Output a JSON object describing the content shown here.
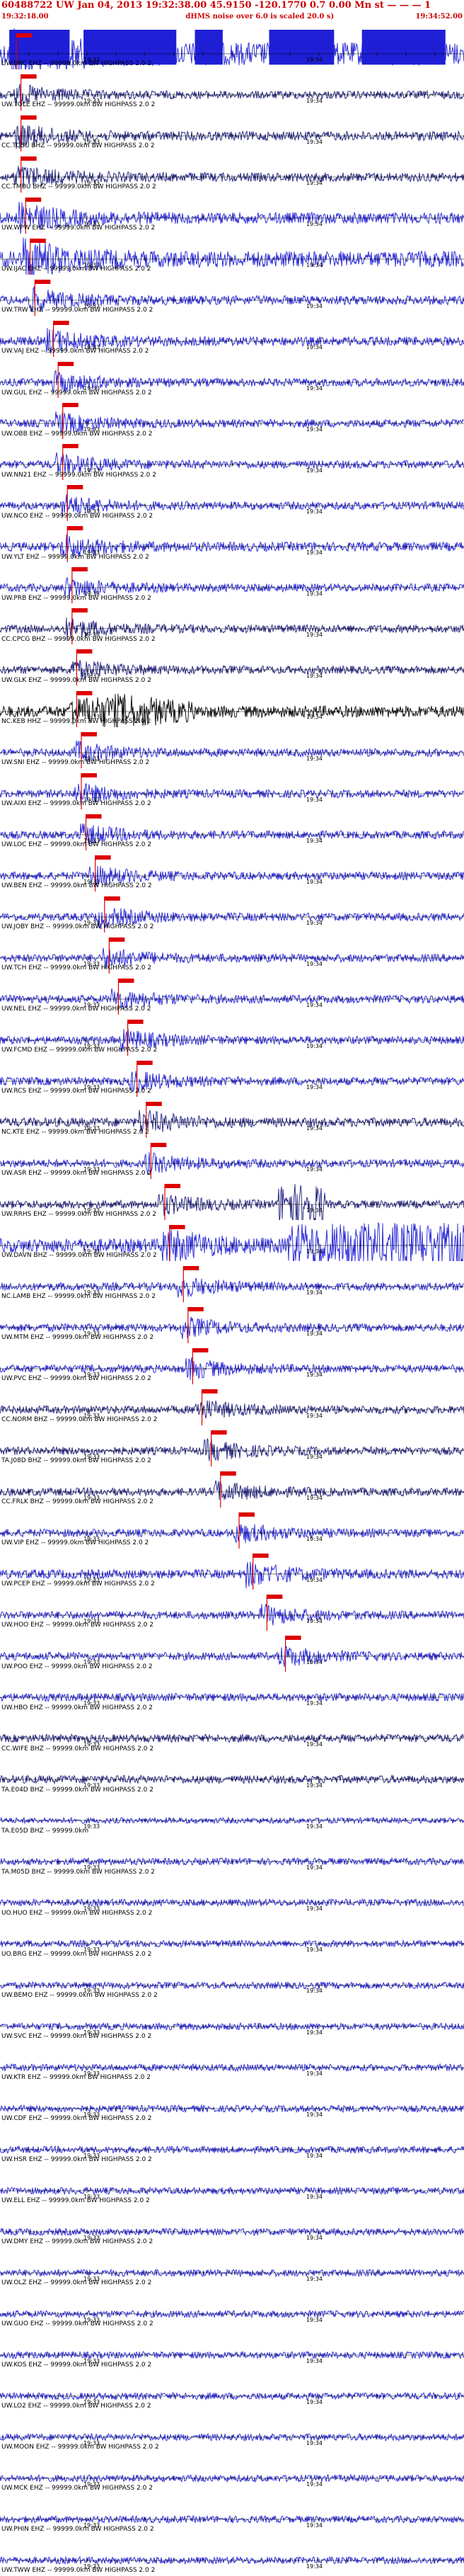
{
  "header": {
    "title": "60488722 UW Jan 04, 2013 19:32:38.00   45.9150 -120.1770  0.7 0.00 Mn st — — — 1",
    "subtitle": "dHMS noise over 6.0 is scaled 20.0 s)",
    "start_time": "19:32:18.00",
    "end_time": "19:34:52.00"
  },
  "colors": {
    "trace_blue": "#1f1fd6",
    "trace_navy": "#1a1a7a",
    "trace_black": "#000000",
    "pick_red": "#dd0000"
  },
  "tick_labels": {
    "left": "19:33",
    "right": "19:34"
  },
  "traces": [
    {
      "label": "UW.BRC EHZ -- 99999.0km BW HIGHPASS  2.0  2",
      "color": "blue",
      "amp": 1.0,
      "pick": 0.02,
      "burst": "box"
    },
    {
      "label": "UW.TOLE EHZ -- 99999.0km BW HIGHPASS  2.0  2",
      "color": "navy",
      "amp": 0.35,
      "pick": 0.03
    },
    {
      "label": "CC.TCBU BHZ -- 99999.0km BW HIGHPASS  2.0  2",
      "color": "navy",
      "amp": 0.4,
      "pick": 0.03
    },
    {
      "label": "CC.TMBU BHZ -- 99999.0km BW HIGHPASS  2.0  2",
      "color": "navy",
      "amp": 0.4,
      "pick": 0.03
    },
    {
      "label": "UW.WPW EHZ -- 99999.0km BW HIGHPASS  2.0  2",
      "color": "blue",
      "amp": 0.5,
      "pick": 0.04
    },
    {
      "label": "UW.IJAC EHZ -- 99999.0km BW HIGHPASS  2.0  2",
      "color": "blue",
      "amp": 0.7,
      "pick": 0.05
    },
    {
      "label": "UW.TRW EHZ -- 99999.0km BW HIGHPASS  2.0  2",
      "color": "blue",
      "amp": 0.4,
      "pick": 0.06
    },
    {
      "label": "UW.VAJ EHZ -- 99999.0km BW HIGHPASS  2.0  2",
      "color": "blue",
      "amp": 0.4,
      "pick": 0.1
    },
    {
      "label": "UW.GUL EHZ -- 99999.0km BW HIGHPASS  2.0  2",
      "color": "blue",
      "amp": 0.35,
      "pick": 0.11
    },
    {
      "label": "UW.OBB EHZ -- 99999.0km BW HIGHPASS  2.0  2",
      "color": "blue",
      "amp": 0.35,
      "pick": 0.12
    },
    {
      "label": "UW.NN21 EHZ -- 99999.0km BW HIGHPASS  2.0  2",
      "color": "blue",
      "amp": 0.35,
      "pick": 0.12
    },
    {
      "label": "UW.NCO EHZ -- 99999.0km BW HIGHPASS  2.0  2",
      "color": "blue",
      "amp": 0.35,
      "pick": 0.13
    },
    {
      "label": "UW.YLT EHZ -- 99999.0km BW HIGHPASS  2.0  2",
      "color": "blue",
      "amp": 0.4,
      "pick": 0.13
    },
    {
      "label": "UW.PRB EHZ -- 99999.0km BW HIGHPASS  2.0  2",
      "color": "blue",
      "amp": 0.35,
      "pick": 0.14
    },
    {
      "label": "CC.CPCG BHZ -- 99999.0km BW HIGHPASS  2.0  2",
      "color": "navy",
      "amp": 0.35,
      "pick": 0.14
    },
    {
      "label": "UW.GLK EHZ -- 99999.0km BW HIGHPASS  2.0  2",
      "color": "navy",
      "amp": 0.35,
      "pick": 0.15
    },
    {
      "label": "NC.KEB HHZ -- 99999.0km BW HIGHPASS  2.0  2",
      "color": "black",
      "amp": 0.5,
      "pick": 0.15,
      "burst": "black"
    },
    {
      "label": "UW.SNI EHZ -- 99999.0km BW HIGHPASS  2.0  2",
      "color": "blue",
      "amp": 0.35,
      "pick": 0.16
    },
    {
      "label": "UW.AIXI EHZ -- 99999.0km BW HIGHPASS  2.0  2",
      "color": "blue",
      "amp": 0.35,
      "pick": 0.16
    },
    {
      "label": "UW.LOC EHZ -- 99999.0km BW HIGHPASS  2.0  2",
      "color": "blue",
      "amp": 0.35,
      "pick": 0.17
    },
    {
      "label": "UW.BEN EHZ -- 99999.0km BW HIGHPASS  2.0  2",
      "color": "blue",
      "amp": 0.35,
      "pick": 0.19
    },
    {
      "label": "UW.JOBY BHZ -- 99999.0km BW HIGHPASS  2.0  2",
      "color": "blue",
      "amp": 0.35,
      "pick": 0.21
    },
    {
      "label": "UW.TCH EHZ -- 99999.0km BW HIGHPASS  2.0  2",
      "color": "blue",
      "amp": 0.35,
      "pick": 0.22
    },
    {
      "label": "UW.NEL EHZ -- 99999.0km BW HIGHPASS  2.0  2",
      "color": "blue",
      "amp": 0.35,
      "pick": 0.24
    },
    {
      "label": "UW.FCMD EHZ -- 99999.0km BW HIGHPASS  2.0  2",
      "color": "blue",
      "amp": 0.35,
      "pick": 0.26
    },
    {
      "label": "UW.RCS EHZ -- 99999.0km BW HIGHPASS  2.0  2",
      "color": "blue",
      "amp": 0.35,
      "pick": 0.28
    },
    {
      "label": "NC.KTE EHZ -- 99999.0km BW HIGHPASS  2.0  2",
      "color": "navy",
      "amp": 0.4,
      "pick": 0.3
    },
    {
      "label": "UW.ASR EHZ -- 99999.0km BW HIGHPASS  2.0  2",
      "color": "blue",
      "amp": 0.35,
      "pick": 0.31
    },
    {
      "label": "UW.RRHS EHZ -- 99999.0km BW HIGHPASS  2.0  2",
      "color": "navy",
      "amp": 0.35,
      "pick": 0.34,
      "burst": "navy"
    },
    {
      "label": "UW.DAVN BHZ -- 99999.0km BW HIGHPASS  2.0  2",
      "color": "blue",
      "amp": 0.6,
      "pick": 0.35,
      "burst": "blue"
    },
    {
      "label": "NC.LAMB EHZ -- 99999.0km BW HIGHPASS  2.0  2",
      "color": "blue",
      "amp": 0.35,
      "pick": 0.38
    },
    {
      "label": "UW.MTM EHZ -- 99999.0km BW HIGHPASS  2.0  2",
      "color": "blue",
      "amp": 0.35,
      "pick": 0.39
    },
    {
      "label": "UW.PVC EHZ -- 99999.0km BW HIGHPASS  2.0  2",
      "color": "blue",
      "amp": 0.35,
      "pick": 0.4
    },
    {
      "label": "CC.NORM BHZ -- 99999.0km BW HIGHPASS  2.0  2",
      "color": "navy",
      "amp": 0.35,
      "pick": 0.42
    },
    {
      "label": "TA.J08D BHZ -- 99999.0km BW HIGHPASS  2.0  2",
      "color": "navy",
      "amp": 0.35,
      "pick": 0.44
    },
    {
      "label": "CC.FRLK BHZ -- 99999.0km BW HIGHPASS  2.0  2",
      "color": "navy",
      "amp": 0.35,
      "pick": 0.46
    },
    {
      "label": "UW.VIP EHZ -- 99999.0km BW HIGHPASS  2.0  2",
      "color": "blue",
      "amp": 0.35,
      "pick": 0.5
    },
    {
      "label": "UW.PCEP EHZ -- 99999.0km BW HIGHPASS  2.0  2",
      "color": "blue",
      "amp": 0.4,
      "pick": 0.53
    },
    {
      "label": "UW.HOO EHZ -- 99999.0km BW HIGHPASS  2.0  2",
      "color": "blue",
      "amp": 0.35,
      "pick": 0.56
    },
    {
      "label": "UW.POO EHZ -- 99999.0km BW HIGHPASS  2.0  2",
      "color": "blue",
      "amp": 0.35,
      "pick": 0.6
    },
    {
      "label": "UW.HBO EHZ -- 99999.0km BW HIGHPASS  2.0  2",
      "color": "blue",
      "amp": 0.35,
      "pick": null
    },
    {
      "label": "CC.WIFE BHZ -- 99999.0km BW HIGHPASS  2.0  2",
      "color": "navy",
      "amp": 0.35,
      "pick": null
    },
    {
      "label": "TA.E04D BHZ -- 99999.0km BW HIGHPASS  2.0  2",
      "color": "navy",
      "amp": 0.35,
      "pick": null
    },
    {
      "label": "TA.E05D BHZ -- 99999.0km",
      "color": "blue",
      "amp": 0.25,
      "pick": null
    },
    {
      "label": "TA.M05D BHZ -- 99999.0km BW HIGHPASS  2.0  2",
      "color": "blue",
      "amp": 0.3,
      "pick": null
    },
    {
      "label": "UO.HUO EHZ -- 99999.0km BW HIGHPASS  2.0  2",
      "color": "blue",
      "amp": 0.3,
      "pick": null
    },
    {
      "label": "UO.BRG EHZ -- 99999.0km BW HIGHPASS  2.0  2",
      "color": "blue",
      "amp": 0.3,
      "pick": null
    },
    {
      "label": "UW.BEMO EHZ -- 99999.0km BW HIGHPASS  2.0  2",
      "color": "blue",
      "amp": 0.3,
      "pick": null
    },
    {
      "label": "UW.SVC EHZ -- 99999.0km BW HIGHPASS  2.0  2",
      "color": "blue",
      "amp": 0.3,
      "pick": null
    },
    {
      "label": "UW.KTR EHZ -- 99999.0km BW HIGHPASS  2.0  2",
      "color": "blue",
      "amp": 0.3,
      "pick": null
    },
    {
      "label": "UW.CDF EHZ -- 99999.0km BW HIGHPASS  2.0  2",
      "color": "blue",
      "amp": 0.3,
      "pick": null
    },
    {
      "label": "UW.HSR EHZ -- 99999.0km BW HIGHPASS  2.0  2",
      "color": "blue",
      "amp": 0.3,
      "pick": null
    },
    {
      "label": "UW.ELL EHZ -- 99999.0km BW HIGHPASS  2.0  2",
      "color": "blue",
      "amp": 0.3,
      "pick": null
    },
    {
      "label": "UW.DMY EHZ -- 99999.0km BW HIGHPASS  2.0  2",
      "color": "blue",
      "amp": 0.3,
      "pick": null
    },
    {
      "label": "UW.OLZ EHZ -- 99999.0km BW HIGHPASS  2.0  2",
      "color": "blue",
      "amp": 0.3,
      "pick": null
    },
    {
      "label": "UW.GUO EHZ -- 99999.0km BW HIGHPASS  2.0  2",
      "color": "blue",
      "amp": 0.3,
      "pick": null
    },
    {
      "label": "UW.KOS EHZ -- 99999.0km BW HIGHPASS  2.0  2",
      "color": "blue",
      "amp": 0.3,
      "pick": null
    },
    {
      "label": "UW.LO2 EHZ -- 99999.0km BW HIGHPASS  2.0  2",
      "color": "blue",
      "amp": 0.3,
      "pick": null
    },
    {
      "label": "UW.MOON EHZ -- 99999.0km BW HIGHPASS  2.0  2",
      "color": "blue",
      "amp": 0.3,
      "pick": null
    },
    {
      "label": "UW.MCK EHZ -- 99999.0km BW HIGHPASS  2.0  2",
      "color": "blue",
      "amp": 0.3,
      "pick": null
    },
    {
      "label": "UW.PHIN EHZ -- 99999.0km BW HIGHPASS  2.0  2",
      "color": "blue",
      "amp": 0.3,
      "pick": null
    },
    {
      "label": "UW.TWW EHZ -- 99999.0km BW HIGHPASS  2.0  2",
      "color": "blue",
      "amp": 0.3,
      "pick": null
    }
  ]
}
